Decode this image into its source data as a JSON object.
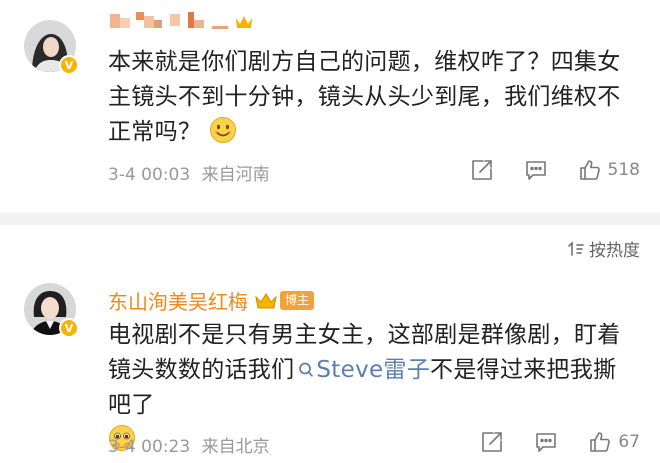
{
  "comments": [
    {
      "username": "",
      "body_text": "本来就是你们剧方自己的问题，维权咋了？四集女主镜头不到十分钟，镜头从头少到尾，我们维权不正常吗？",
      "time": "3-4 00:03",
      "location": "来自河南",
      "like_count": "518",
      "emoji": "smile-emoji"
    },
    {
      "username": "东山洵美吴红梅",
      "badge_label": "博主",
      "body_part1": "电视剧不是只有男主女主，这部剧是群像剧，盯着镜头数数的话我们",
      "mention": "Steve雷子",
      "body_part2": "不是得过来把我撕吧了",
      "time": "3-4 00:23",
      "location": "来自北京",
      "like_count": "67",
      "emoji": "pleading-emoji"
    }
  ],
  "sort": {
    "label": "按热度"
  },
  "colors": {
    "username": "#ee8a1a",
    "mention": "#5b7fb0",
    "meta": "#999999",
    "badge": "#f6b400"
  }
}
